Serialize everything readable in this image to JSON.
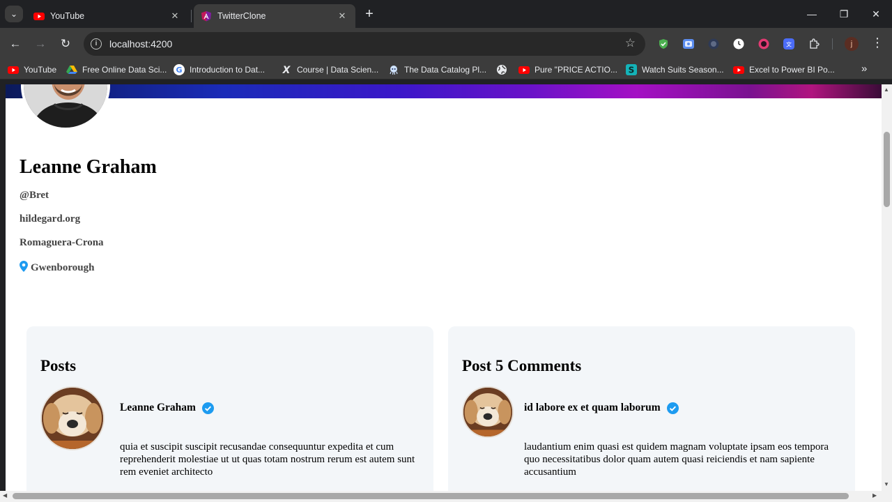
{
  "browser": {
    "tabs": [
      {
        "title": "YouTube",
        "icon": "youtube-icon",
        "active": false
      },
      {
        "title": "TwitterClone",
        "icon": "angular-icon",
        "active": true
      }
    ],
    "address": "localhost:4200",
    "profile_initial": "j",
    "bookmarks": [
      {
        "label": "YouTube",
        "icon": "youtube-icon"
      },
      {
        "label": "Free Online Data Sci...",
        "icon": "drive-icon"
      },
      {
        "label": "Introduction to Dat...",
        "icon": "google-icon"
      },
      {
        "label": "Course | Data Scien...",
        "icon": "x-icon"
      },
      {
        "label": "The Data Catalog Pl...",
        "icon": "octopus-icon"
      },
      {
        "label": "",
        "icon": "globe-icon"
      },
      {
        "label": "Pure \"PRICE ACTIO...",
        "icon": "youtube-icon"
      },
      {
        "label": "Watch Suits Season...",
        "icon": "s-icon"
      },
      {
        "label": "Excel to Power BI Po...",
        "icon": "youtube-icon"
      }
    ]
  },
  "profile": {
    "name": "Leanne Graham",
    "username": "@Bret",
    "website": "hildegard.org",
    "company": "Romaguera-Crona",
    "city": "Gwenborough"
  },
  "posts_card": {
    "title": "Posts",
    "author": "Leanne Graham",
    "body": "quia et suscipit suscipit recusandae consequuntur expedita et cum reprehenderit molestiae ut ut quas totam nostrum rerum est autem sunt rem eveniet architecto"
  },
  "comments_card": {
    "title": "Post 5 Comments",
    "author": "id labore ex et quam laborum",
    "body": "laudantium enim quasi est quidem magnam voluptate ipsam eos tempora quo necessitatibus dolor quam autem quasi reiciendis et nam sapiente accusantium"
  },
  "colors": {
    "accent_blue": "#1d9bf0",
    "youtube_red": "#ff0000",
    "page_bg": "#ffffff",
    "card_bg": "#f3f6f9"
  }
}
